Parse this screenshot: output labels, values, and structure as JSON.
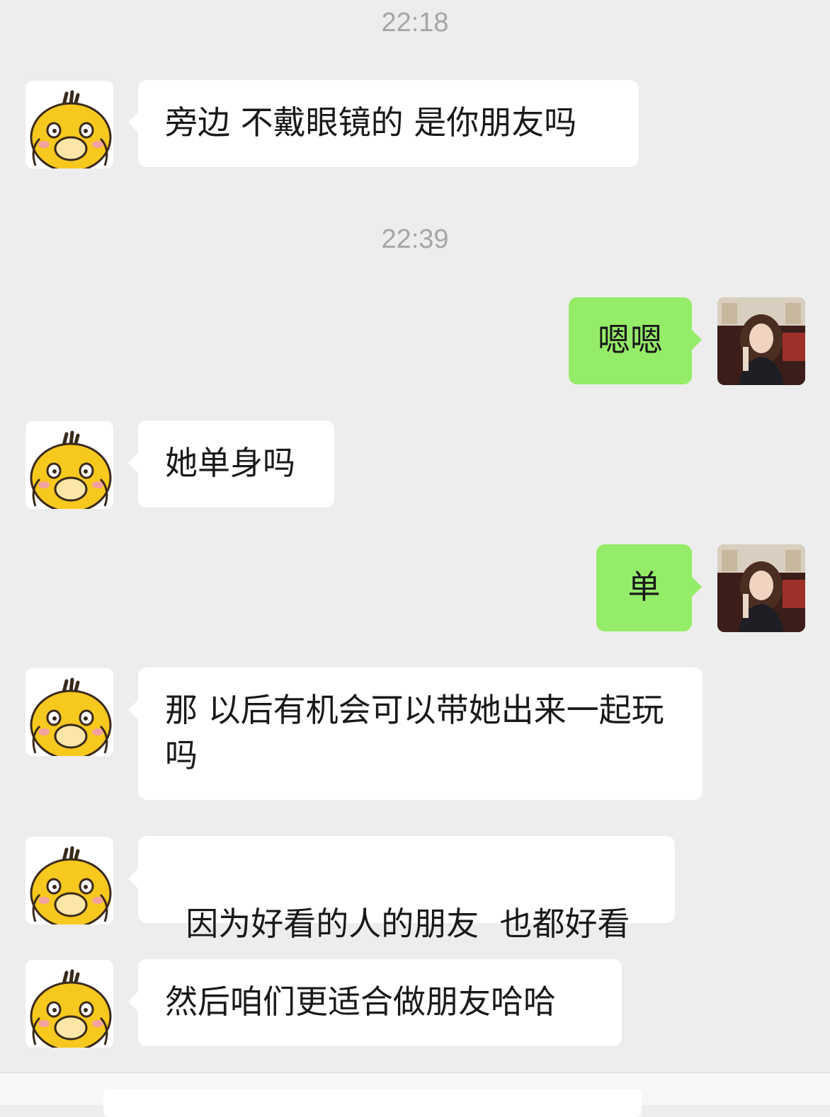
{
  "timestamps": [
    "22:18",
    "22:39"
  ],
  "messages": [
    {
      "sender": "other",
      "text": "旁边 不戴眼镜的 是你朋友吗"
    },
    {
      "sender": "me",
      "text": "嗯嗯"
    },
    {
      "sender": "other",
      "text": "她单身吗"
    },
    {
      "sender": "me",
      "text": "单"
    },
    {
      "sender": "other",
      "text": "那 以后有机会可以带她出来一起玩吗"
    },
    {
      "sender": "other",
      "text": "因为好看的人的朋友  也都好看"
    },
    {
      "sender": "other",
      "text": "然后咱们更适合做朋友哈哈"
    }
  ],
  "colors": {
    "background": "#ededed",
    "incoming_bubble": "#ffffff",
    "outgoing_bubble": "#95ec69",
    "timestamp_text": "#a6a6a6"
  },
  "icons": {
    "other_avatar": "yellow-duck-avatar",
    "my_avatar": "profile-photo-avatar"
  }
}
